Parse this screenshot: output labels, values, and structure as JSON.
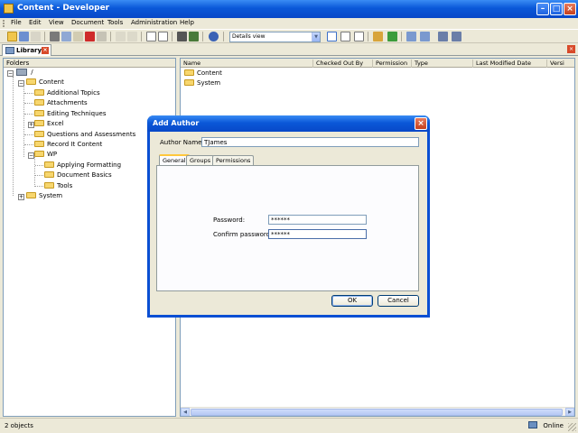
{
  "window": {
    "title": "Content - Developer"
  },
  "menu": [
    "File",
    "Edit",
    "View",
    "Document",
    "Tools",
    "Administration",
    "Help"
  ],
  "toolbar": {
    "view_select_value": "Details view"
  },
  "library_tab": {
    "label": "Library"
  },
  "folders_pane": {
    "header": "Folders",
    "root": "/",
    "tree": [
      {
        "label": "Content"
      },
      {
        "label": "Additional Topics"
      },
      {
        "label": "Attachments"
      },
      {
        "label": "Editing Techniques"
      },
      {
        "label": "Excel"
      },
      {
        "label": "Questions and Assessments"
      },
      {
        "label": "Record It Content"
      },
      {
        "label": "WP"
      },
      {
        "label": "Applying Formatting"
      },
      {
        "label": "Document Basics"
      },
      {
        "label": "Tools"
      },
      {
        "label": "System"
      }
    ]
  },
  "list_pane": {
    "columns": [
      "Name",
      "Checked Out By",
      "Permission",
      "Type",
      "Last Modified Date",
      "Versi"
    ],
    "rows": [
      "Content",
      "System"
    ]
  },
  "status_bar": {
    "count": "2 objects",
    "connection": "Online"
  },
  "dialog": {
    "title": "Add Author",
    "author_name_label": "Author Name:",
    "author_name_value": "TJames",
    "tabs": [
      "General",
      "Groups",
      "Permissions"
    ],
    "password_label": "Password:",
    "password_value": "******",
    "confirm_label": "Confirm password:",
    "confirm_value": "******",
    "ok_label": "OK",
    "cancel_label": "Cancel"
  }
}
